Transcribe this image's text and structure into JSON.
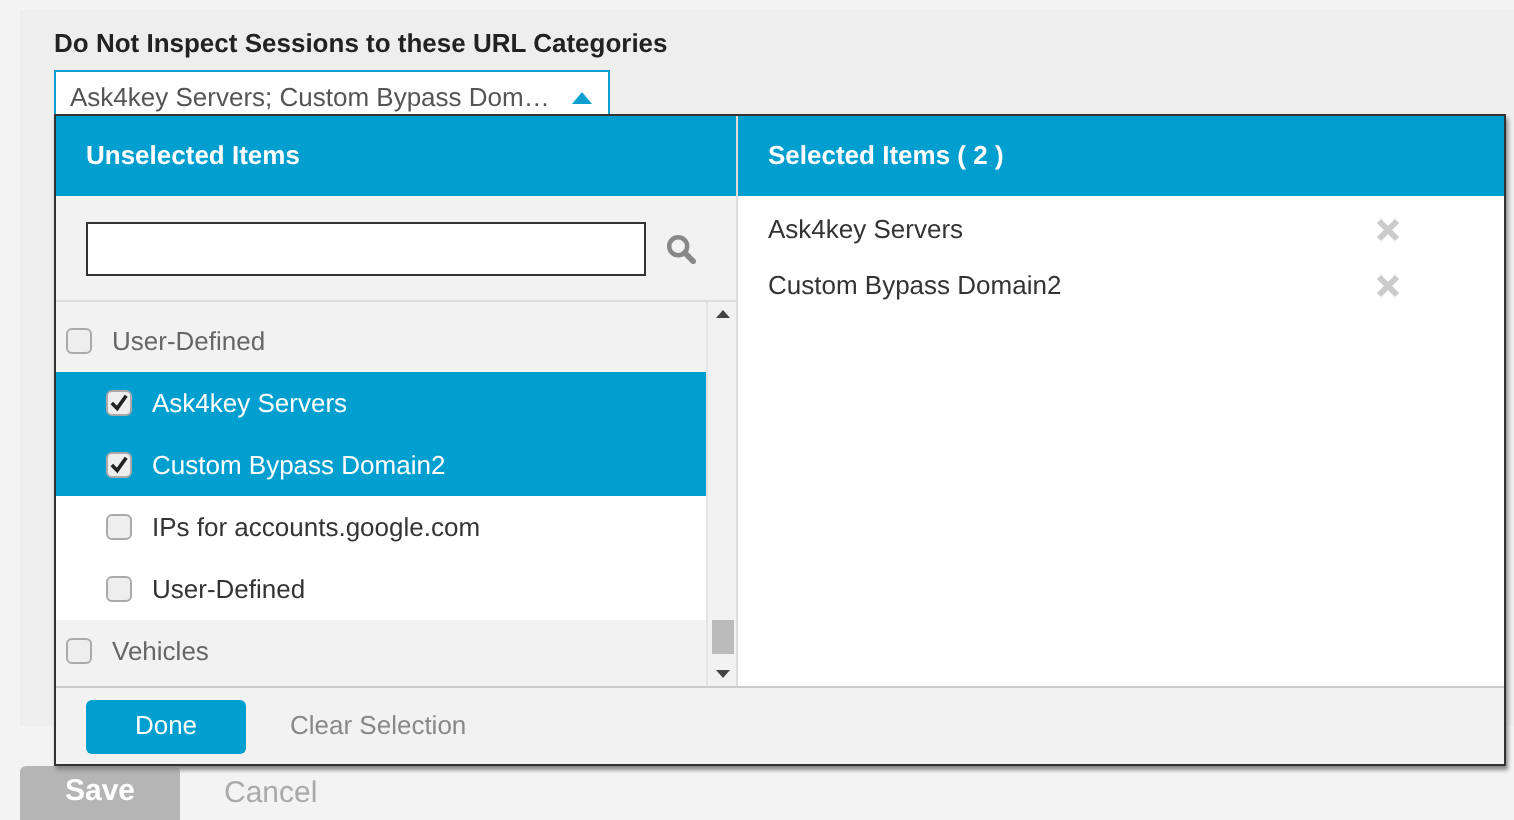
{
  "field": {
    "label": "Do Not Inspect Sessions to these URL Categories",
    "value": "Ask4key Servers; Custom Bypass Dom…",
    "expanded": true
  },
  "popup": {
    "unselected_header": "Unselected Items",
    "selected_header": "Selected Items ( 2 )",
    "groups": [
      {
        "label": "User-Defined",
        "checked": false,
        "children": [
          {
            "label": "Ask4key Servers",
            "checked": true,
            "selected": true
          },
          {
            "label": "Custom Bypass Domain2",
            "checked": true,
            "selected": true
          },
          {
            "label": "IPs for accounts.google.com",
            "checked": false,
            "selected": false
          },
          {
            "label": "User-Defined",
            "checked": false,
            "selected": false
          }
        ]
      },
      {
        "label": "Vehicles",
        "checked": false
      }
    ],
    "selected_items": [
      "Ask4key Servers",
      "Custom Bypass Domain2"
    ],
    "done_button": "Done",
    "clear_link": "Clear Selection"
  },
  "buttons": {
    "save": "Save",
    "cancel": "Cancel"
  }
}
